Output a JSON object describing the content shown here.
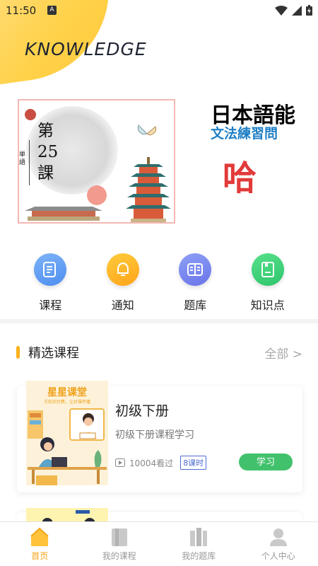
{
  "status_bar": {
    "time": "11:50",
    "badge": "A"
  },
  "header": {
    "brand": "KNOWLEDGE"
  },
  "banner": {
    "slide_main": {
      "tag": "単語",
      "lines": [
        "第",
        "25",
        "課"
      ]
    },
    "slide_side": {
      "title": "日本語能",
      "subtitle": "文法練習問",
      "big_char": "哈"
    }
  },
  "quick_nav": [
    {
      "label": "课程",
      "icon": "course-icon"
    },
    {
      "label": "通知",
      "icon": "bell-icon"
    },
    {
      "label": "题库",
      "icon": "book-icon"
    },
    {
      "label": "知识点",
      "icon": "knowledge-icon"
    }
  ],
  "section": {
    "title": "精选课程",
    "more": "全部 >"
  },
  "courses": [
    {
      "cover_title": "星星课堂",
      "cover_subtitle": "方知识付费，让好课传播",
      "title": "初级下册",
      "description": "初级下册课程学习",
      "views": "10004看过",
      "lessons": "8课时",
      "button": "学习"
    }
  ],
  "bottom_nav": [
    {
      "label": "首页",
      "active": true
    },
    {
      "label": "我的课程",
      "active": false
    },
    {
      "label": "我的题库",
      "active": false
    },
    {
      "label": "个人中心",
      "active": false
    }
  ],
  "colors": {
    "accent": "#ffb21c",
    "study_button": "#42c16c",
    "lesson_tag": "#4b6bd3"
  }
}
